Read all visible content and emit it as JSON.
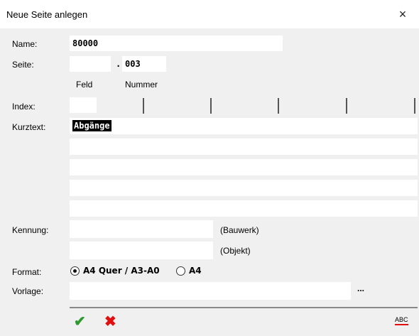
{
  "window": {
    "title": "Neue Seite anlegen",
    "close_glyph": "×"
  },
  "labels": {
    "name": "Name:",
    "seite": "Seite:",
    "feld": "Feld",
    "nummer": "Nummer",
    "index": "Index:",
    "kurztext": "Kurztext:",
    "kennung": "Kennung:",
    "bauwerk": "(Bauwerk)",
    "objekt": "(Objekt)",
    "format": "Format:",
    "vorlage": "Vorlage:"
  },
  "fields": {
    "name": "80000",
    "seite_feld": "",
    "seite_dot": ".",
    "seite_nummer": "003",
    "index": "",
    "kurztext_lines": [
      "Abgänge",
      "",
      "",
      "",
      ""
    ],
    "kennung_bauwerk": "",
    "kennung_objekt": "",
    "vorlage": "",
    "browse_label": "..."
  },
  "format": {
    "options": [
      "A4 Quer / A3-A0",
      "A4"
    ],
    "selected": "A4 Quer / A3-A0"
  },
  "footer": {
    "ok_glyph": "✔",
    "cancel_glyph": "✖",
    "spellcheck_label": "ABC"
  },
  "colors": {
    "ok": "#2e9a2e",
    "cancel": "#e01010",
    "background": "#f0f0f0"
  }
}
